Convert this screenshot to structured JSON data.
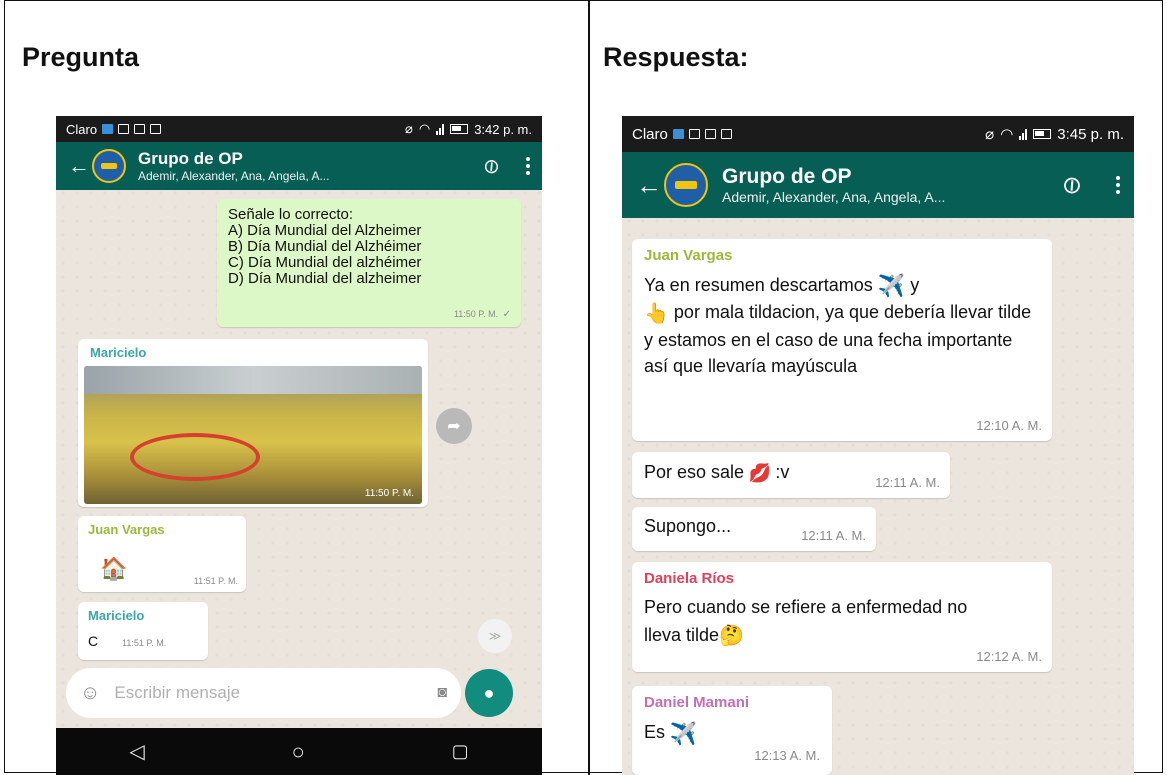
{
  "headings": {
    "left": "Pregunta",
    "right": "Respuesta:"
  },
  "left_phone": {
    "status": {
      "carrier": "Claro",
      "time": "3:42 p. m."
    },
    "header": {
      "title": "Grupo de OP",
      "subtitle": "Ademir, Alexander, Ana, Angela, A..."
    },
    "messages": [
      {
        "text": "Señale lo correcto:\nA) Día Mundial del Alzheimer\nB) Día Mundial del Alzhéimer\nC) Día Mundial del alzhéimer\nD) Día Mundial del alzheimer",
        "time": "11:50 P. M."
      },
      {
        "sender": "Maricielo",
        "time": "11:50 P. M."
      },
      {
        "sender": "Juan Vargas",
        "emoji": "🏠",
        "time": "11:51 P. M."
      },
      {
        "sender": "Maricielo",
        "text": "C",
        "time": "11:51 P. M."
      }
    ],
    "input": {
      "placeholder": "Escribir mensaje"
    }
  },
  "right_phone": {
    "status": {
      "carrier": "Claro",
      "time": "3:45 p. m."
    },
    "header": {
      "title": "Grupo de OP",
      "subtitle": "Ademir, Alexander, Ana, Angela, A..."
    },
    "messages": [
      {
        "sender": "Juan Vargas",
        "line1": "Ya en resumen descartamos",
        "emoji1": "✈️",
        "line1b": "y",
        "emoji2": "👆",
        "line2": "por mala tildacion, ya que debería llevar tilde y estamos en el caso de una fecha importante así que llevaría mayúscula",
        "time": "12:10 A. M."
      },
      {
        "text": "Por eso sale",
        "emoji": "💋",
        "text2": ":v",
        "time": "12:11 A. M."
      },
      {
        "text": "Supongo...",
        "time": "12:11 A. M."
      },
      {
        "sender": "Daniela Ríos",
        "text": "Pero cuando se refiere a enfermedad no lleva tilde",
        "emoji": "🤔",
        "time": "12:12 A. M."
      },
      {
        "sender": "Daniel Mamani",
        "text": "Es",
        "emoji": "✈️",
        "time": "12:13 A. M."
      }
    ]
  },
  "colors": {
    "header": "#075e54",
    "chat_bg": "#ece5dd",
    "outgoing": "#dcf8c6",
    "fab": "#128c7e",
    "juan": "#9ab93a",
    "maricielo": "#3ba6a6",
    "daniela": "#e0405a",
    "daniel": "#c36fb3"
  }
}
